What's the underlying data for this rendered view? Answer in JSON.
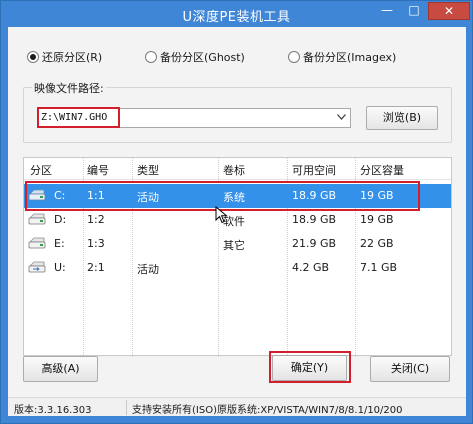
{
  "window": {
    "title": "U深度PE装机工具",
    "minimize_glyph": "—",
    "maximize_glyph": "□",
    "close_glyph": "✕"
  },
  "mode_options": [
    {
      "label": "还原分区(R)",
      "checked": true
    },
    {
      "label": "备份分区(Ghost)",
      "checked": false
    },
    {
      "label": "备份分区(Imagex)",
      "checked": false
    }
  ],
  "image_path": {
    "group_label": "映像文件路径:",
    "value": "Z:\\WIN7.GHO",
    "browse_label": "浏览(B)"
  },
  "partition_table": {
    "columns": [
      "分区",
      "编号",
      "类型",
      "卷标",
      "可用空间",
      "分区容量"
    ],
    "rows": [
      {
        "drive": "C:",
        "number": "1:1",
        "type": "活动",
        "label": "系统",
        "free": "18.9 GB",
        "capacity": "19 GB",
        "selected": true
      },
      {
        "drive": "D:",
        "number": "1:2",
        "type": "",
        "label": "软件",
        "free": "18.9 GB",
        "capacity": "19 GB",
        "selected": false
      },
      {
        "drive": "E:",
        "number": "1:3",
        "type": "",
        "label": "其它",
        "free": "21.9 GB",
        "capacity": "22 GB",
        "selected": false
      },
      {
        "drive": "U:",
        "number": "2:1",
        "type": "活动",
        "label": "",
        "free": "4.2 GB",
        "capacity": "7.1 GB",
        "selected": false
      }
    ]
  },
  "buttons": {
    "advanced": "高级(A)",
    "ok": "确定(Y)",
    "close": "关闭(C)"
  },
  "statusbar": {
    "version": "版本:3.3.16.303",
    "support": "支持安装所有(ISO)原版系统:XP/VISTA/WIN7/8/8.1/10/200"
  },
  "colors": {
    "titlebar": "#3f86d6",
    "selection": "#3391ea",
    "annotation_red": "#d21f2b",
    "close_button": "#c74b40"
  },
  "icons": {
    "drive": "hard-drive-icon",
    "usb": "usb-drive-icon",
    "combo": "chevron-down-icon",
    "cursor": "mouse-cursor-icon"
  }
}
